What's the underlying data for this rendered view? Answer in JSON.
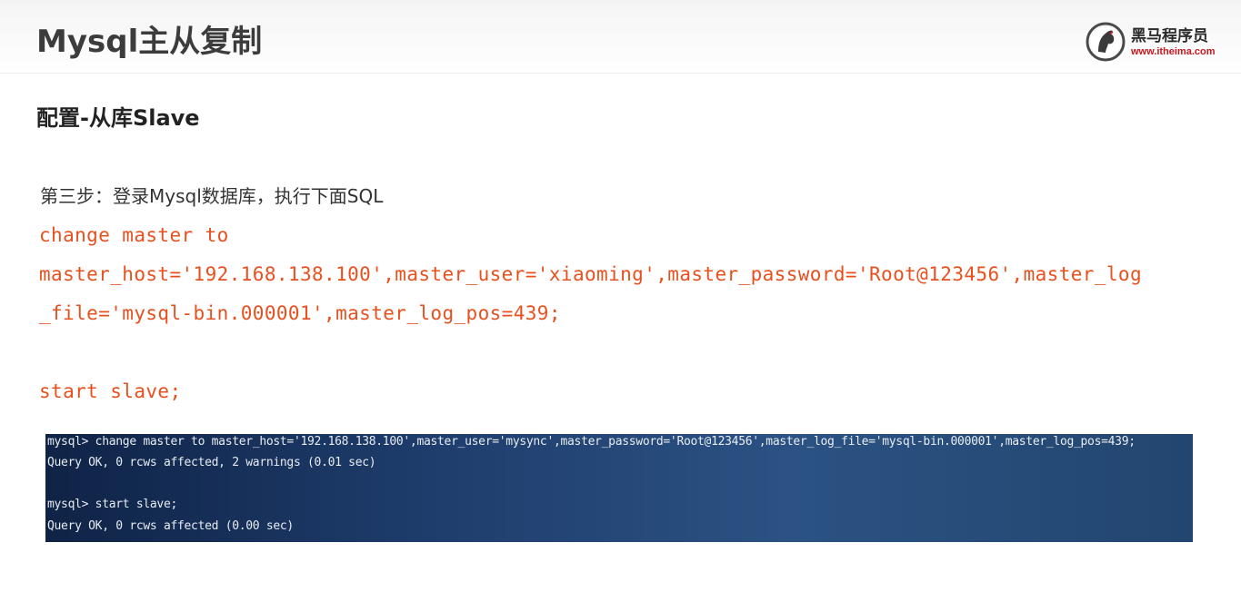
{
  "header": {
    "title": "Mysql主从复制",
    "logo": {
      "name": "黑马程序员",
      "url": "www.itheima.com"
    }
  },
  "content": {
    "section_title": "配置-从库Slave",
    "step": "第三步：登录Mysql数据库，执行下面SQL",
    "code_lines": [
      "change master to",
      "master_host='192.168.138.100',master_user='xiaoming',master_password='Root@123456',master_log",
      "_file='mysql-bin.000001',master_log_pos=439;",
      "start slave;"
    ]
  },
  "terminal": {
    "lines": [
      "mysql> change master to master_host='192.168.138.100',master_user='mysync',master_password='Root@123456',master_log_file='mysql-bin.000001',master_log_pos=439;",
      "Query OK, 0 rcws affected, 2 warnings (0.01 sec)",
      "mysql> start slave;",
      "Query OK, 0 rcws affected (0.00 sec)"
    ]
  },
  "colors": {
    "code": "#e8501e",
    "title": "#3c3c3c",
    "brand_red": "#c8161d",
    "terminal_bg": "#1f3e6e",
    "terminal_text": "#e8ecf2"
  },
  "icons": {
    "logo": "horse-head-logo-icon"
  }
}
